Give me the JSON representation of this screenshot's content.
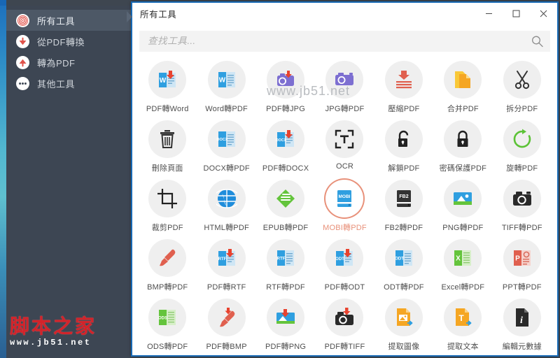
{
  "sidebar": {
    "items": [
      {
        "label": "所有工具",
        "icon": "target-icon",
        "active": true
      },
      {
        "label": "從PDF轉換",
        "icon": "arrow-down-circle-icon",
        "active": false
      },
      {
        "label": "轉為PDF",
        "icon": "arrow-up-circle-icon",
        "active": false
      },
      {
        "label": "其他工具",
        "icon": "ellipsis-circle-icon",
        "active": false
      }
    ]
  },
  "watermark": {
    "text_cn": "脚本之家",
    "url": "www.jb51.net"
  },
  "window": {
    "title": "所有工具",
    "buttons": {
      "minimize": "minimize-icon",
      "maximize": "maximize-icon",
      "close": "close-icon"
    },
    "border_color": "#1769b5"
  },
  "search": {
    "value": "",
    "placeholder": "查找工具...",
    "icon": "search-icon"
  },
  "grid_watermark": "www.jb51.net",
  "colors": {
    "accent_selected": "#e8917a",
    "sidebar_bg": "#3d4653",
    "sidebar_active_bg": "#4d5866",
    "tool_circle_bg": "#efefef",
    "search_bg": "#f3f3f3"
  },
  "tools": [
    {
      "label": "PDF轉Word",
      "icon": "pdf-to-word-icon",
      "selected": false
    },
    {
      "label": "Word轉PDF",
      "icon": "word-to-pdf-icon",
      "selected": false
    },
    {
      "label": "PDF轉JPG",
      "icon": "pdf-to-jpg-icon",
      "selected": false
    },
    {
      "label": "JPG轉PDF",
      "icon": "jpg-to-pdf-icon",
      "selected": false
    },
    {
      "label": "壓縮PDF",
      "icon": "compress-pdf-icon",
      "selected": false
    },
    {
      "label": "合并PDF",
      "icon": "merge-pdf-icon",
      "selected": false
    },
    {
      "label": "拆分PDF",
      "icon": "split-pdf-icon",
      "selected": false
    },
    {
      "label": "刪除頁面",
      "icon": "delete-pages-icon",
      "selected": false
    },
    {
      "label": "DOCX轉PDF",
      "icon": "docx-to-pdf-icon",
      "selected": false
    },
    {
      "label": "PDF轉DOCX",
      "icon": "pdf-to-docx-icon",
      "selected": false
    },
    {
      "label": "OCR",
      "icon": "ocr-icon",
      "selected": false
    },
    {
      "label": "解鎖PDF",
      "icon": "unlock-pdf-icon",
      "selected": false
    },
    {
      "label": "密碼保護PDF",
      "icon": "lock-pdf-icon",
      "selected": false
    },
    {
      "label": "旋轉PDF",
      "icon": "rotate-pdf-icon",
      "selected": false
    },
    {
      "label": "裁剪PDF",
      "icon": "crop-pdf-icon",
      "selected": false
    },
    {
      "label": "HTML轉PDF",
      "icon": "html-to-pdf-icon",
      "selected": false
    },
    {
      "label": "EPUB轉PDF",
      "icon": "epub-to-pdf-icon",
      "selected": false
    },
    {
      "label": "MOBI轉PDF",
      "icon": "mobi-to-pdf-icon",
      "selected": true
    },
    {
      "label": "FB2轉PDF",
      "icon": "fb2-to-pdf-icon",
      "selected": false
    },
    {
      "label": "PNG轉PDF",
      "icon": "png-to-pdf-icon",
      "selected": false
    },
    {
      "label": "TIFF轉PDF",
      "icon": "tiff-to-pdf-icon",
      "selected": false
    },
    {
      "label": "BMP轉PDF",
      "icon": "bmp-to-pdf-icon",
      "selected": false
    },
    {
      "label": "PDF轉RTF",
      "icon": "pdf-to-rtf-icon",
      "selected": false
    },
    {
      "label": "RTF轉PDF",
      "icon": "rtf-to-pdf-icon",
      "selected": false
    },
    {
      "label": "PDF轉ODT",
      "icon": "pdf-to-odt-icon",
      "selected": false
    },
    {
      "label": "ODT轉PDF",
      "icon": "odt-to-pdf-icon",
      "selected": false
    },
    {
      "label": "Excel轉PDF",
      "icon": "excel-to-pdf-icon",
      "selected": false
    },
    {
      "label": "PPT轉PDF",
      "icon": "ppt-to-pdf-icon",
      "selected": false
    },
    {
      "label": "ODS轉PDF",
      "icon": "ods-to-pdf-icon",
      "selected": false
    },
    {
      "label": "PDF轉BMP",
      "icon": "pdf-to-bmp-icon",
      "selected": false
    },
    {
      "label": "PDF轉PNG",
      "icon": "pdf-to-png-icon",
      "selected": false
    },
    {
      "label": "PDF轉TIFF",
      "icon": "pdf-to-tiff-icon",
      "selected": false
    },
    {
      "label": "提取圖像",
      "icon": "extract-images-icon",
      "selected": false
    },
    {
      "label": "提取文本",
      "icon": "extract-text-icon",
      "selected": false
    },
    {
      "label": "編輯元數據",
      "icon": "edit-metadata-icon",
      "selected": false
    }
  ]
}
